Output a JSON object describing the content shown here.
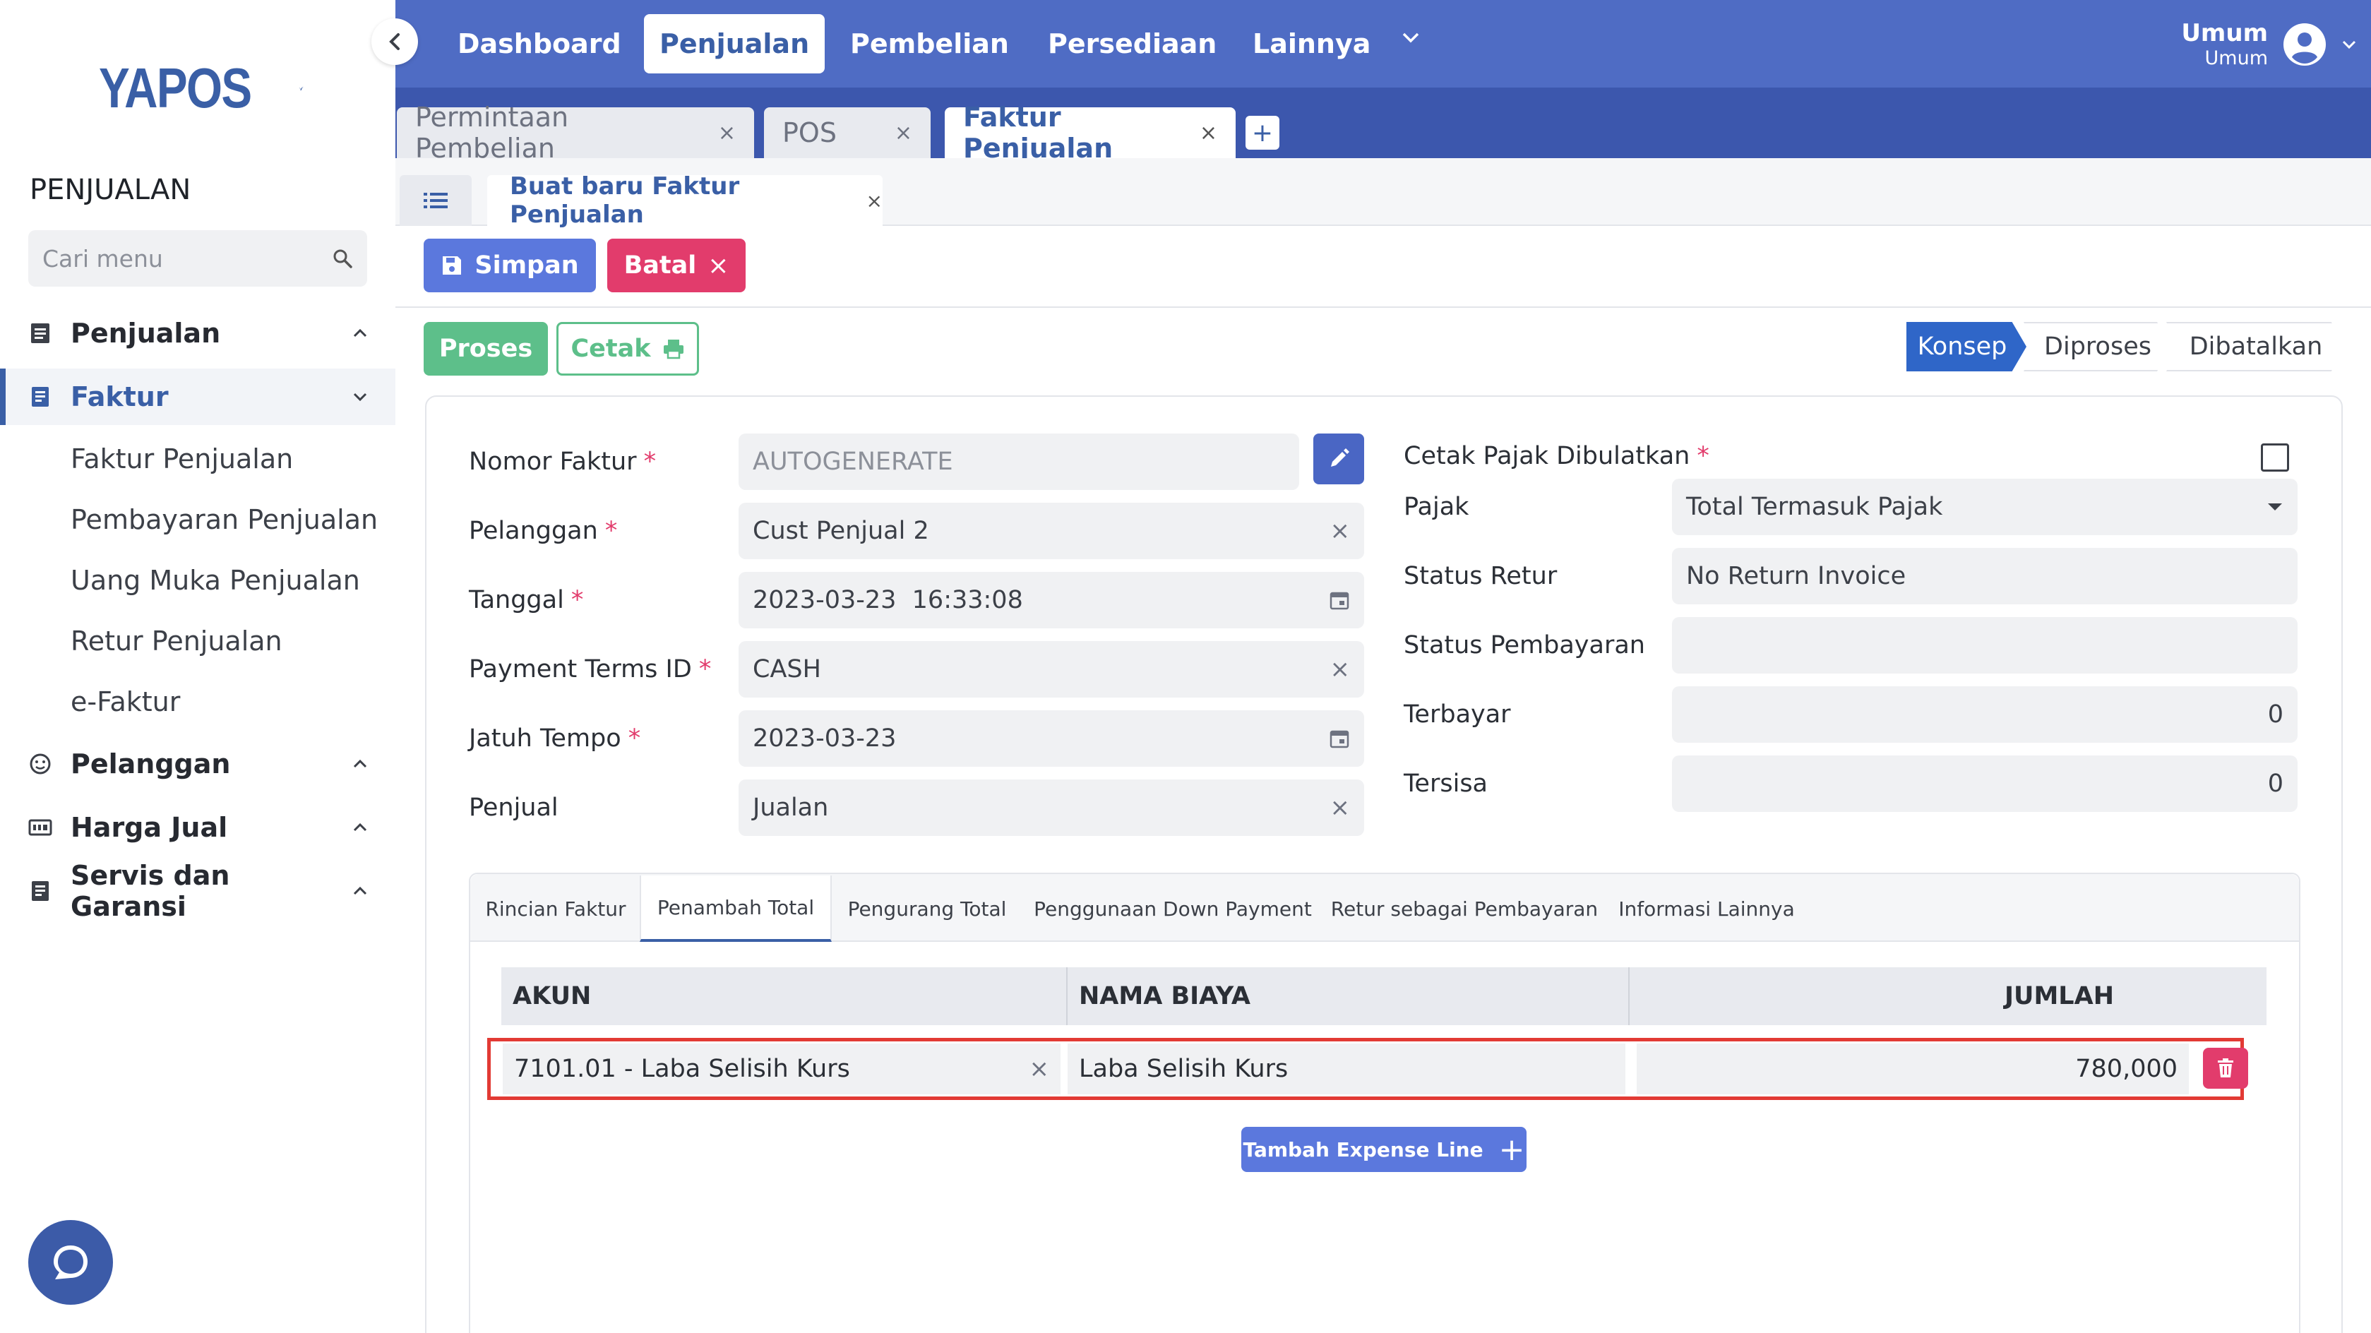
{
  "sidebar": {
    "logo_text": "YAPOS",
    "section_title": "PENJUALAN",
    "search_placeholder": "Cari menu",
    "groups": [
      {
        "label": "Penjualan"
      },
      {
        "label": "Faktur"
      },
      {
        "label": "Pelanggan"
      },
      {
        "label": "Harga Jual"
      },
      {
        "label": "Servis dan Garansi"
      }
    ],
    "faktur_items": [
      {
        "label": "Faktur Penjualan"
      },
      {
        "label": "Pembayaran Penjualan"
      },
      {
        "label": "Uang Muka Penjualan"
      },
      {
        "label": "Retur Penjualan"
      },
      {
        "label": "e-Faktur"
      }
    ]
  },
  "topnav": {
    "items": [
      {
        "label": "Dashboard"
      },
      {
        "label": "Penjualan"
      },
      {
        "label": "Pembelian"
      },
      {
        "label": "Persediaan"
      },
      {
        "label": "Lainnya"
      }
    ],
    "active": "Penjualan",
    "user_name": "Umum",
    "user_role": "Umum"
  },
  "doc_tabs": [
    {
      "label": "Permintaan Pembelian",
      "close": "×"
    },
    {
      "label": "POS",
      "close": "×"
    },
    {
      "label": "Faktur Penjualan",
      "close": "×"
    }
  ],
  "doc_tab_add": "+",
  "form_tab": {
    "label": "Buat baru Faktur Penjualan",
    "close": "×"
  },
  "toolbar": {
    "save_label": "Simpan",
    "cancel_label": "Batal",
    "cancel_x": "×",
    "process_label": "Proses",
    "print_label": "Cetak"
  },
  "status_steps": [
    {
      "label": "Konsep"
    },
    {
      "label": "Diproses"
    },
    {
      "label": "Dibatalkan"
    }
  ],
  "required_mark": "*",
  "clear_mark": "×",
  "form_left": {
    "nomor_faktur": {
      "label": "Nomor Faktur",
      "placeholder": "AUTOGENERATE"
    },
    "pelanggan": {
      "label": "Pelanggan",
      "value": "Cust Penjual 2"
    },
    "tanggal": {
      "label": "Tanggal",
      "value": "2023-03-23  16:33:08"
    },
    "payment_terms": {
      "label": "Payment Terms ID",
      "value": "CASH"
    },
    "jatuh_tempo": {
      "label": "Jatuh Tempo",
      "value": "2023-03-23"
    },
    "penjual": {
      "label": "Penjual",
      "value": "Jualan"
    }
  },
  "form_right": {
    "cetak_pajak": {
      "label": "Cetak Pajak Dibulatkan",
      "checked": false
    },
    "pajak": {
      "label": "Pajak",
      "value": "Total Termasuk Pajak"
    },
    "status_retur": {
      "label": "Status Retur",
      "value": "No Return Invoice"
    },
    "status_pembayaran": {
      "label": "Status Pembayaran",
      "value": ""
    },
    "terbayar": {
      "label": "Terbayar",
      "value": "0"
    },
    "tersisa": {
      "label": "Tersisa",
      "value": "0"
    }
  },
  "inner_tabs": [
    {
      "label": "Rincian Faktur"
    },
    {
      "label": "Penambah Total"
    },
    {
      "label": "Pengurang Total"
    },
    {
      "label": "Penggunaan Down Payment"
    },
    {
      "label": "Retur sebagai Pembayaran"
    },
    {
      "label": "Informasi Lainnya"
    }
  ],
  "inner_tab_active": "Penambah Total",
  "expense_table": {
    "headers": [
      "AKUN",
      "NAMA BIAYA",
      "JUMLAH"
    ],
    "rows": [
      {
        "akun": "7101.01 - Laba Selisih Kurs",
        "nama_biaya": "Laba Selisih Kurs",
        "jumlah": "780,000"
      }
    ],
    "add_label": "Tambah Expense Line",
    "add_plus": "+"
  },
  "colors": {
    "brand": "#3a5fa6",
    "topbar": "#4f6cc4",
    "primary": "#5b78dd",
    "danger": "#e23c6c",
    "success": "#5dbf8a",
    "highlight": "#e23a34"
  }
}
